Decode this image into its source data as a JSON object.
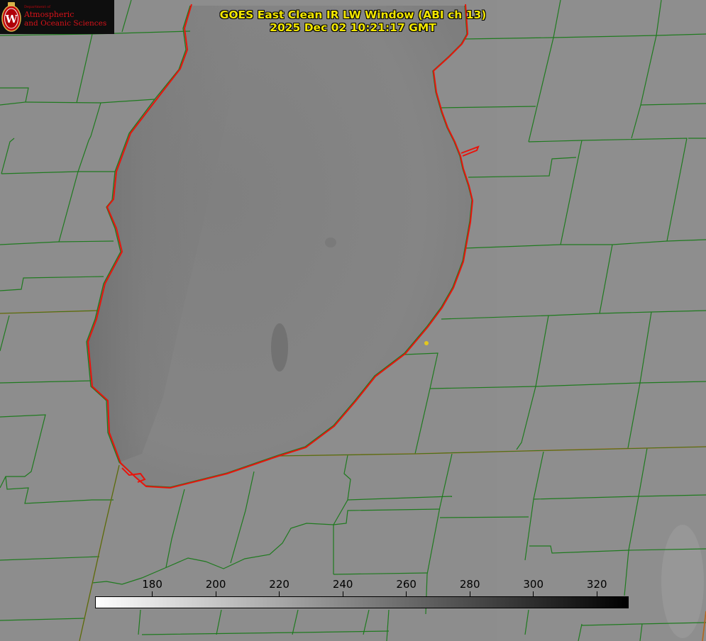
{
  "header": {
    "title": "GOES East Clean IR LW Window (ABI ch 13)",
    "timestamp": "2025 Dec 02 10:21:17 GMT"
  },
  "logo": {
    "department": "Department of",
    "name_line1": "Atmospheric",
    "name_line2": "and Oceanic Sciences",
    "seal_letter": "W"
  },
  "colorbar": {
    "ticks": [
      "180",
      "200",
      "220",
      "240",
      "260",
      "280",
      "300",
      "320"
    ],
    "min": 162,
    "max": 330,
    "gradient": [
      "#ffffff",
      "#000000"
    ]
  },
  "colors": {
    "county_lines": "#1f7a1f",
    "state_lines": "#b5651d",
    "lake_shoreline": "#e8140c",
    "title_text": "#f2e600",
    "marker": "#e3c81e"
  }
}
